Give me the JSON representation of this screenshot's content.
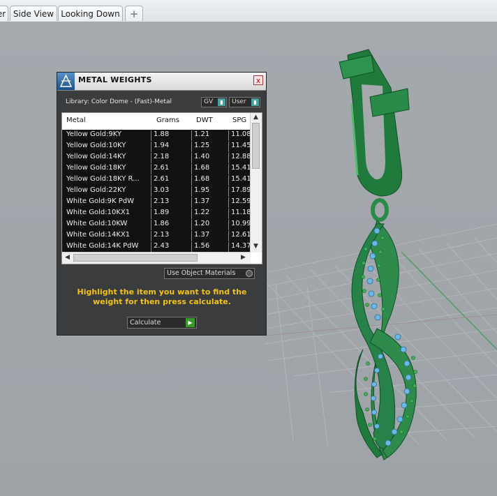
{
  "tabs": [
    {
      "label": "er"
    },
    {
      "label": "Side View"
    },
    {
      "label": "Looking Down"
    },
    {
      "label": "+"
    }
  ],
  "panel": {
    "title": "METAL WEIGHTS",
    "close_label": "x",
    "library_label": "Library: Color Dome - (Fast)-Metal",
    "gv_label": "GV",
    "user_label": "User",
    "columns": [
      "Metal",
      "Grams",
      "DWT",
      "SPG"
    ],
    "rows": [
      {
        "metal": "Yellow Gold:9KY",
        "grams": "1.88",
        "dwt": "1.21",
        "spg": "11.08"
      },
      {
        "metal": "Yellow Gold:10KY",
        "grams": "1.94",
        "dwt": "1.25",
        "spg": "11.45"
      },
      {
        "metal": "Yellow Gold:14KY",
        "grams": "2.18",
        "dwt": "1.40",
        "spg": "12.88"
      },
      {
        "metal": "Yellow Gold:18KY",
        "grams": "2.61",
        "dwt": "1.68",
        "spg": "15.41"
      },
      {
        "metal": "Yellow Gold:18KY R...",
        "grams": "2.61",
        "dwt": "1.68",
        "spg": "15.41"
      },
      {
        "metal": "Yellow Gold:22KY",
        "grams": "3.03",
        "dwt": "1.95",
        "spg": "17.89"
      },
      {
        "metal": "White Gold:9K PdW",
        "grams": "2.13",
        "dwt": "1.37",
        "spg": "12.59"
      },
      {
        "metal": "White Gold:10KX1",
        "grams": "1.89",
        "dwt": "1.22",
        "spg": "11.18"
      },
      {
        "metal": "White Gold:10KW",
        "grams": "1.86",
        "dwt": "1.20",
        "spg": "10.99"
      },
      {
        "metal": "White Gold:14KX1",
        "grams": "2.13",
        "dwt": "1.37",
        "spg": "12.61"
      },
      {
        "metal": "White Gold:14K PdW",
        "grams": "2.43",
        "dwt": "1.56",
        "spg": "14.37"
      }
    ],
    "use_object_materials_label": "Use Object Materials",
    "instructions": "Highlight the item you want to find the weight for then press calculate.",
    "calculate_label": "Calculate"
  },
  "colors": {
    "panel_bg": "#3b3c3d",
    "instruction_text": "#f2c21c",
    "model_green": "#2e8b4c",
    "gem_blue": "#6ab8e6"
  }
}
